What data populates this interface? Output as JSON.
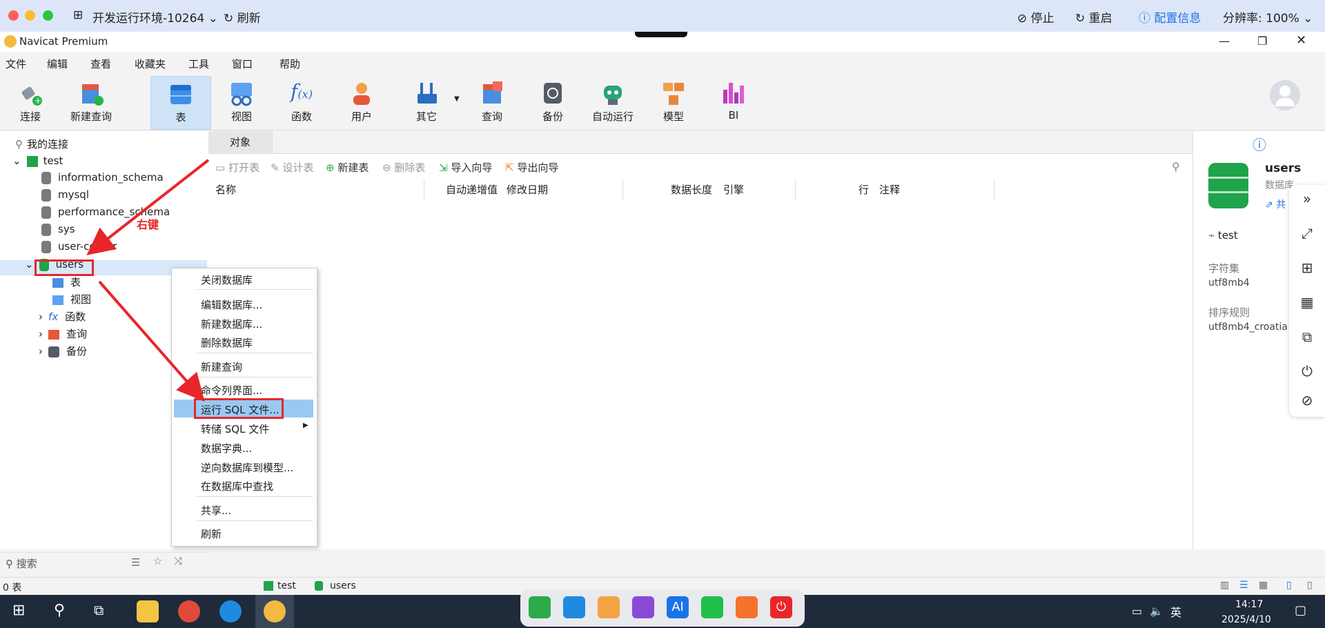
{
  "remote_bar": {
    "env_title": "开发运行环境-10264",
    "refresh": "刷新",
    "stop": "停止",
    "restart": "重启",
    "config_info": "配置信息",
    "resolution": "分辨率: 100%"
  },
  "app": {
    "title": "Navicat Premium"
  },
  "menu": [
    "文件",
    "编辑",
    "查看",
    "收藏夹",
    "工具",
    "窗口",
    "帮助"
  ],
  "toolbar": {
    "connect": "连接",
    "new_query": "新建查询",
    "table": "表",
    "view": "视图",
    "function": "函数",
    "user": "用户",
    "other": "其它",
    "query": "查询",
    "backup": "备份",
    "automation": "自动运行",
    "model": "模型",
    "bi": "BI"
  },
  "tree": {
    "my_connections": "我的连接",
    "connection": "test",
    "databases": [
      "information_schema",
      "mysql",
      "performance_schema",
      "sys",
      "user-center",
      "users"
    ],
    "children": [
      "表",
      "视图",
      "函数",
      "查询",
      "备份"
    ]
  },
  "annotation": {
    "right_click": "右键"
  },
  "left_search": {
    "placeholder": "搜索"
  },
  "tabs": {
    "objects": "对象"
  },
  "object_toolbar": {
    "open_table": "打开表",
    "design_table": "设计表",
    "new_table": "新建表",
    "delete_table": "删除表",
    "import_wizard": "导入向导",
    "export_wizard": "导出向导"
  },
  "columns": [
    "名称",
    "自动递增值",
    "修改日期",
    "数据长度",
    "引擎",
    "行",
    "注释"
  ],
  "context_menu": {
    "close_db": "关闭数据库",
    "edit_db": "编辑数据库...",
    "new_db": "新建数据库...",
    "delete_db": "删除数据库",
    "new_query": "新建查询",
    "console": "命令列界面...",
    "run_sql": "运行 SQL 文件...",
    "dump_sql": "转储 SQL 文件",
    "data_dict": "数据字典...",
    "reverse_model": "逆向数据库到模型...",
    "find_in_db": "在数据库中查找",
    "share": "共享...",
    "refresh": "刷新"
  },
  "info_panel": {
    "name": "users",
    "type": "数据库",
    "share_link": "共",
    "connection": "test",
    "charset_label": "字符集",
    "charset_value": "utf8mb4",
    "collation_label": "排序规则",
    "collation_value": "utf8mb4_croatia"
  },
  "status": {
    "count": "0 表",
    "conn": "test",
    "db": "users"
  },
  "taskbar": {
    "time": "14:17",
    "date": "2025/4/10",
    "ime": "英"
  },
  "colors": {
    "accent": "#1a73e8",
    "highlight_red": "#e8262a",
    "menu_selected": "#99c9f2",
    "db_green": "#20a34a"
  }
}
